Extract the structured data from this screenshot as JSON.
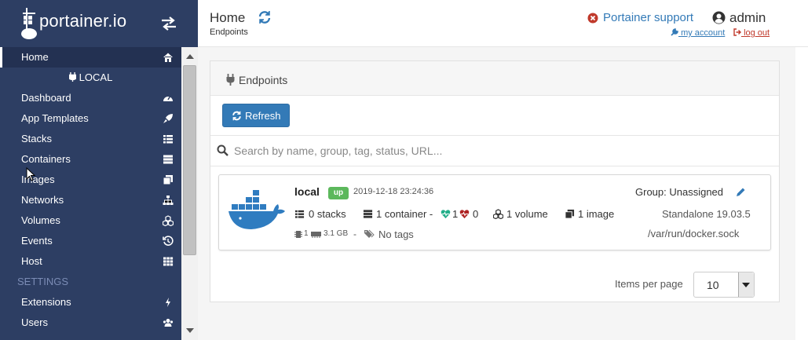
{
  "brand": {
    "logo_text": "portainer.io"
  },
  "sidebar": {
    "home": "Home",
    "endpoint": "LOCAL",
    "items": [
      {
        "label": "Dashboard",
        "icon": "tachometer-icon"
      },
      {
        "label": "App Templates",
        "icon": "rocket-icon"
      },
      {
        "label": "Stacks",
        "icon": "th-list-icon"
      },
      {
        "label": "Containers",
        "icon": "server-icon"
      },
      {
        "label": "Images",
        "icon": "clone-icon"
      },
      {
        "label": "Networks",
        "icon": "sitemap-icon"
      },
      {
        "label": "Volumes",
        "icon": "cubes-icon"
      },
      {
        "label": "Events",
        "icon": "history-icon"
      },
      {
        "label": "Host",
        "icon": "th-icon"
      }
    ],
    "settings_heading": "SETTINGS",
    "settings_items": [
      {
        "label": "Extensions",
        "icon": "bolt-icon"
      },
      {
        "label": "Users",
        "icon": "users-icon"
      }
    ]
  },
  "header": {
    "title": "Home",
    "breadcrumb": "Endpoints",
    "support": "Portainer support",
    "username": "admin",
    "my_account": "my account",
    "log_out": "log out"
  },
  "endpoints_panel": {
    "title": "Endpoints",
    "refresh_button": "Refresh",
    "search_placeholder": "Search by name, group, tag, status, URL..."
  },
  "endpoint": {
    "name": "local",
    "status": "up",
    "date": "2019-12-18 23:24:36",
    "stacks": "0 stacks",
    "containers": "1 container -",
    "healthy": "1",
    "unhealthy": "0",
    "volumes": "1 volume",
    "images": "1 image",
    "cpu": "1",
    "memory": "3.1 GB",
    "separator": "-",
    "tags": "No tags",
    "group": "Group: Unassigned",
    "type": "Standalone 19.03.5",
    "url": "/var/run/docker.sock"
  },
  "pagination": {
    "label": "Items per page",
    "value": "10"
  },
  "colors": {
    "sidebar": "#2d3e63",
    "primary": "#337ab7",
    "status_up": "#5cb85c",
    "healthy": "#23ae89",
    "unhealthy": "#ae2323",
    "docker_blue": "#2f7cc0"
  }
}
